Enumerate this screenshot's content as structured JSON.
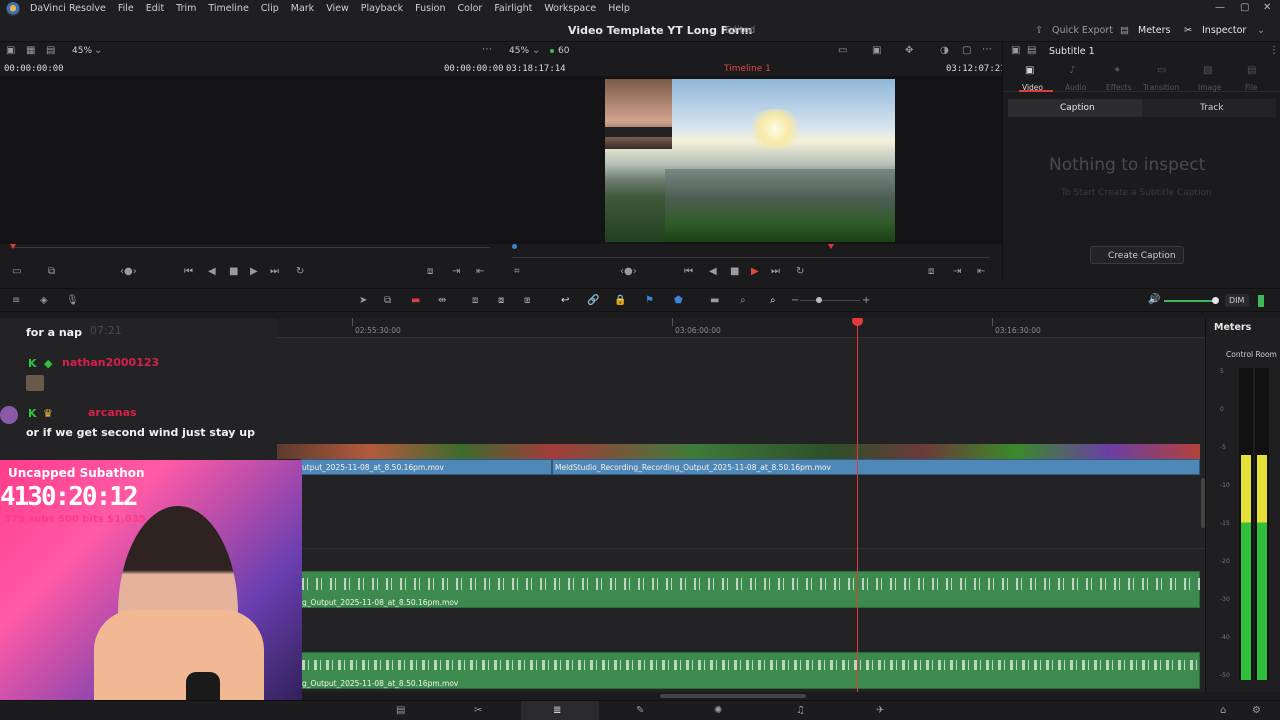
{
  "app": {
    "name": "DaVinci Resolve",
    "menu": [
      "File",
      "Edit",
      "Trim",
      "Timeline",
      "Clip",
      "Mark",
      "View",
      "Playback",
      "Fusion",
      "Color",
      "Fairlight",
      "Workspace",
      "Help"
    ]
  },
  "header": {
    "project_title": "Video Template YT Long Form",
    "status": "Edited",
    "quick_export": "Quick Export",
    "meters": "Meters",
    "inspector": "Inspector"
  },
  "source_viewer": {
    "zoom": "45%",
    "timecode_left": "00:00:00:00",
    "timecode_right": "00:00:00:00"
  },
  "timeline_viewer": {
    "zoom": "45%",
    "fps": "60",
    "duration": "03:18:17:14",
    "timeline_name": "Timeline 1",
    "current_timecode": "03:12:07:21"
  },
  "inspector_panel": {
    "title": "Subtitle 1",
    "tabs": [
      "Video",
      "Audio",
      "Effects",
      "Transition",
      "Image",
      "File"
    ],
    "subtabs": [
      "Caption",
      "Track"
    ],
    "empty_title": "Nothing to inspect",
    "empty_hint": "To Start Create a Subtitle Caption",
    "create_button": "Create Caption"
  },
  "toolbar": {
    "dim_label": "DIM"
  },
  "timeline": {
    "ruler_labels": [
      "02:55:30:00",
      "03:06:00:00",
      "03:16:30:00"
    ],
    "video_clips": [
      {
        "label": "utput_2025-11-08_at_8.50.16pm.mov"
      },
      {
        "label": "MeldStudio_Recording_Recording_Output_2025-11-08_at_8.50.16pm.mov"
      }
    ],
    "audio_clips": [
      {
        "label": "g_Output_2025-11-08_at_8.50.16pm.mov"
      },
      {
        "label": "g_Output_2025-11-08_at_8.50.16pm.mov"
      }
    ]
  },
  "meters_panel": {
    "title": "Meters",
    "section": "Control Room",
    "scale": [
      "5",
      "0",
      "-5",
      "-10",
      "-15",
      "-20",
      "-30",
      "-40",
      "-50"
    ],
    "level_fraction": 0.72
  },
  "chat": {
    "messages": [
      {
        "user": "",
        "text": "for a nap"
      },
      {
        "user": "nathan2000123",
        "text": ""
      },
      {
        "user": "arcanas",
        "text": "or if we get second wind just stay up"
      }
    ],
    "ghost_time": "07:21"
  },
  "stream_overlay": {
    "title": "Uncapped Subathon",
    "timer": "4130:20:12",
    "stats": "379 subs  500 bits  $1,035"
  },
  "colors": {
    "playhead": "#e03b3b",
    "video_clip": "#4f88b7",
    "audio_clip": "#3d8a4f",
    "accent_red": "#d6204c"
  }
}
